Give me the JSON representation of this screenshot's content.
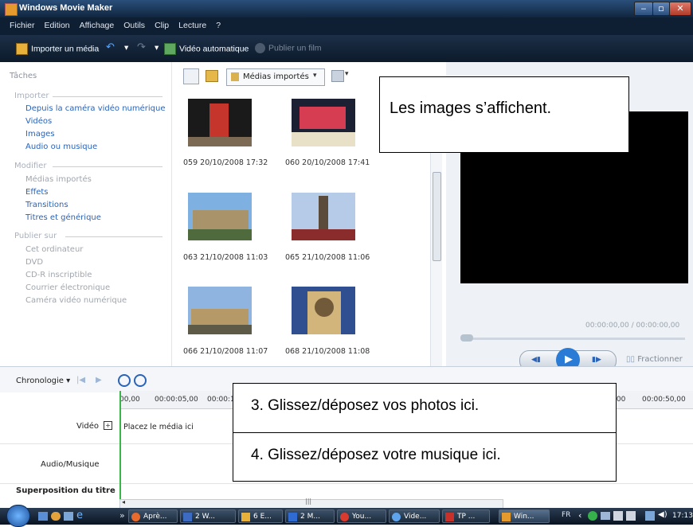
{
  "window": {
    "title": "Windows Movie Maker"
  },
  "menu": [
    "Fichier",
    "Edition",
    "Affichage",
    "Outils",
    "Clip",
    "Lecture",
    "?"
  ],
  "toolbar": {
    "import": "Importer un média",
    "auto_movie": "Vidéo automatique",
    "publish": "Publier un film"
  },
  "tasks": {
    "header": "Tâches",
    "sections": [
      {
        "title": "Importer",
        "items": [
          {
            "label": "Depuis la caméra vidéo numérique",
            "enabled": true
          },
          {
            "label": "Vidéos",
            "enabled": true
          },
          {
            "label": "Images",
            "enabled": true
          },
          {
            "label": "Audio ou musique",
            "enabled": true
          }
        ]
      },
      {
        "title": "Modifier",
        "items": [
          {
            "label": "Médias importés",
            "enabled": false
          },
          {
            "label": "Effets",
            "enabled": true
          },
          {
            "label": "Transitions",
            "enabled": true
          },
          {
            "label": "Titres et générique",
            "enabled": true
          }
        ]
      },
      {
        "title": "Publier sur",
        "items": [
          {
            "label": "Cet ordinateur",
            "enabled": false
          },
          {
            "label": "DVD",
            "enabled": false
          },
          {
            "label": "CD-R inscriptible",
            "enabled": false
          },
          {
            "label": "Courrier électronique",
            "enabled": false
          },
          {
            "label": "Caméra vidéo numérique",
            "enabled": false
          }
        ]
      }
    ]
  },
  "media": {
    "dropdown": "Médias importés",
    "items": [
      {
        "caption": "059 20/10/2008 17:32",
        "palette": [
          "#1a1a1a",
          "#c6352b",
          "#7d6a55"
        ]
      },
      {
        "caption": "060 20/10/2008 17:41",
        "palette": [
          "#1c2033",
          "#d63d52",
          "#e8e1c8"
        ]
      },
      {
        "caption": "063 21/10/2008 11:03",
        "palette": [
          "#7fb0e2",
          "#a9936a",
          "#4f6a3c"
        ]
      },
      {
        "caption": "065 21/10/2008 11:06",
        "palette": [
          "#b5cbe8",
          "#5a4b3b",
          "#8a2c2c"
        ]
      },
      {
        "caption": "066 21/10/2008 11:07",
        "palette": [
          "#8fb4e0",
          "#b59a68",
          "#5d5a48"
        ]
      },
      {
        "caption": "068 21/10/2008 11:08",
        "palette": [
          "#2f4f90",
          "#d2b57a",
          "#705a3a"
        ]
      }
    ]
  },
  "preview": {
    "time": "00:00:00,00 / 00:00:00,00",
    "split": "Fractionner"
  },
  "timeline": {
    "mode": "Chronologie",
    "ruler": [
      "00,00",
      "00:00:05,00",
      "00:00:1",
      ",00",
      "00:00:50,00"
    ],
    "tracks": {
      "video": "Vidéo",
      "video_placeholder": "Placez le média ici",
      "audio": "Audio/Musique",
      "title_overlay": "Superposition du titre"
    }
  },
  "callouts": {
    "images": "Les images s’affichent.",
    "photos": "3. Glissez/déposez vos photos ici.",
    "music": "4. Glissez/déposez votre musique ici."
  },
  "taskbar": {
    "buttons": [
      "Aprè...",
      "2 W...",
      "6 E...",
      "2 M...",
      "You...",
      "Vide...",
      "TP ...",
      "Win..."
    ],
    "lang": "FR",
    "clock": "17:13"
  },
  "colors": {
    "link": "#2a63b8",
    "accent_play": "#2a7bd6"
  }
}
